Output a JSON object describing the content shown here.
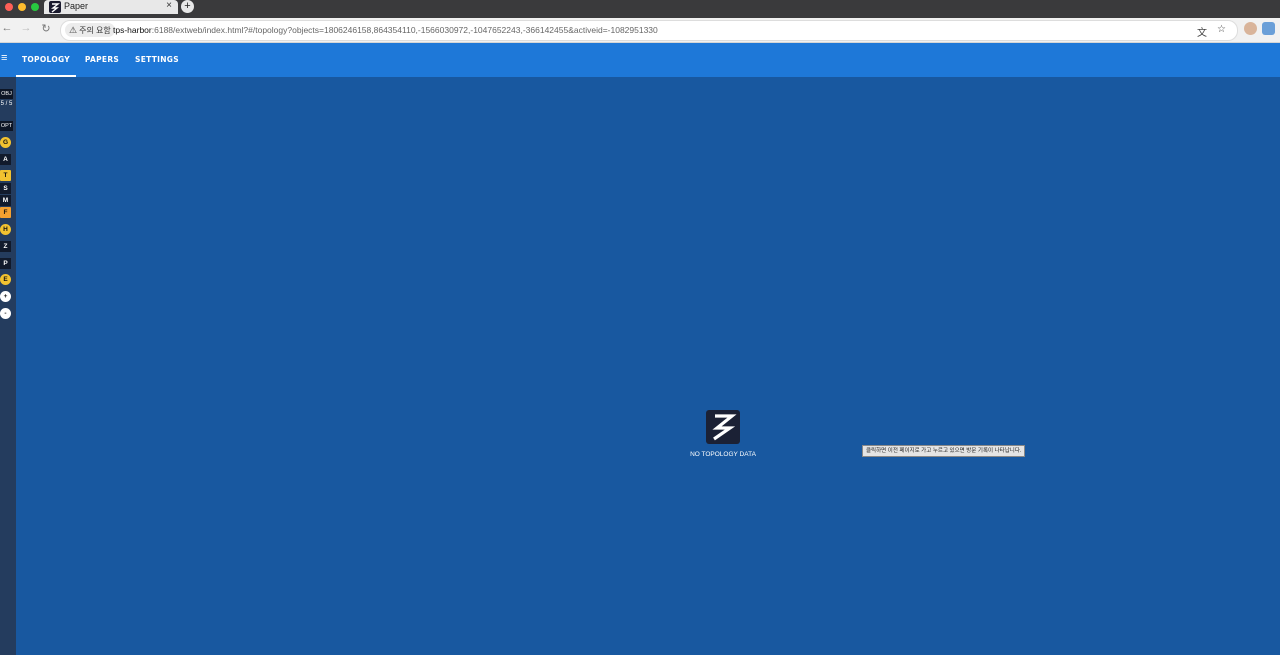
{
  "browser": {
    "tab_title": "Paper",
    "tab_close": "×",
    "new_tab": "+",
    "nav_back": "←",
    "nav_forward": "→",
    "nav_reload": "↻",
    "security_chip": "주의 요함",
    "url_host": "tps-harbor",
    "url_rest": ":6188/extweb/index.html?#/topology?objects=1806246158,864354110,-1566030972,-1047652243,-366142455&activeid=-1082951330",
    "translate_glyph": "文",
    "star_glyph": "☆"
  },
  "app": {
    "menu_glyph": "≡",
    "tabs": [
      {
        "label": "TOPOLOGY",
        "active": true
      },
      {
        "label": "PAPERS",
        "active": false
      },
      {
        "label": "SETTINGS",
        "active": false
      }
    ]
  },
  "sidebar": {
    "obj_label": "OBJ",
    "obj_count": "5 / 5",
    "opt_label": "OPT",
    "buttons": [
      "G",
      "A",
      "T",
      "S",
      "M",
      "F",
      "H",
      "Z",
      "P",
      "E",
      "+",
      "-"
    ]
  },
  "main": {
    "empty_message": "NO TOPOLOGY DATA",
    "tooltip": "클릭하면 이전 페이지로 가고 누르고 있으면 방문 기록이 나타납니다."
  },
  "colors": {
    "canvas_bg": "#1858a0",
    "appbar_bg": "#1e78d8",
    "sidebar_bg": "#243c5e",
    "accent_yellow": "#f2c230"
  }
}
